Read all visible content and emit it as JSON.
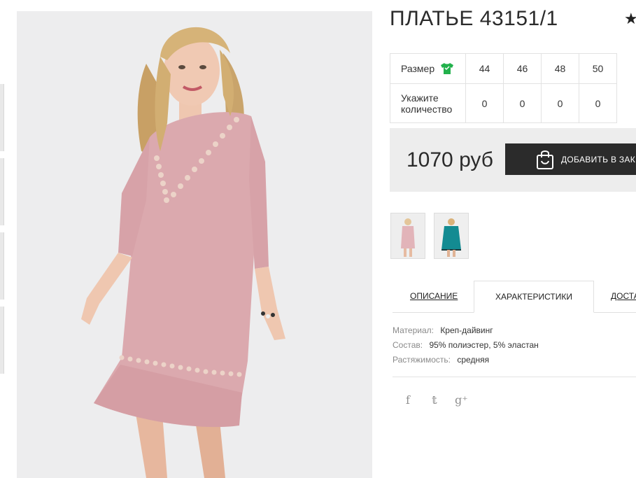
{
  "product": {
    "title": "ПЛАТЬЕ 43151/1",
    "favorite_icon": "star-icon"
  },
  "sizes": {
    "size_label": "Размер",
    "size_icon": "tshirt-icon",
    "size_icon_color": "#22b14c",
    "values": [
      "44",
      "46",
      "48",
      "50"
    ],
    "qty_label_line1": "Укажите",
    "qty_label_line2": "количество",
    "quantities": [
      "0",
      "0",
      "0",
      "0"
    ]
  },
  "buy": {
    "price": "1070 руб",
    "add_label": "ДОБАВИТЬ В ЗАК",
    "add_icon": "shopping-bag-icon",
    "button_color": "#2b2b2b"
  },
  "variants": [
    {
      "name": "pink",
      "color": "#e2b4b9"
    },
    {
      "name": "teal",
      "color": "#138b92"
    }
  ],
  "tabs": [
    {
      "label": "ОПИСАНИЕ",
      "active": false
    },
    {
      "label": "ХАРАКТЕРИСТИКИ",
      "active": true
    },
    {
      "label": "ДОСТА",
      "active": false
    }
  ],
  "specs": [
    {
      "key": "Материал:",
      "value": "Креп-дайвинг"
    },
    {
      "key": "Состав:",
      "value": "95% полиэстер, 5% эластан"
    },
    {
      "key": "Растяжимость:",
      "value": "средняя"
    }
  ],
  "social": {
    "facebook": "f",
    "twitter": "𝕥",
    "google_plus": "g⁺"
  },
  "photo": {
    "dress_color": "#dba9ae",
    "background_color": "#ededee"
  }
}
